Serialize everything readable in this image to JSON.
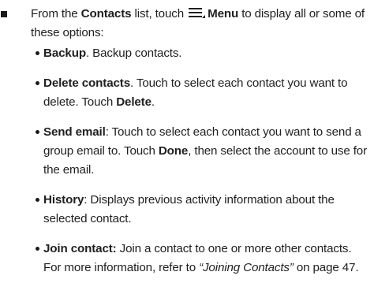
{
  "intro": {
    "part1": "From the ",
    "contacts_label": "Contacts",
    "part2": " list, touch ",
    "menu_icon": "menu-icon",
    "menu_label": "Menu",
    "part3": " to display all or some of these options:"
  },
  "items": [
    {
      "term": "Backup",
      "text1": ". Backup contacts."
    },
    {
      "term": "Delete contacts",
      "text1": ". Touch to select each contact you want to delete. Touch ",
      "emph": "Delete",
      "text2": "."
    },
    {
      "term": "Send email",
      "text1": ": Touch to select each contact you want to send a group email to. Touch ",
      "emph": "Done",
      "text2": ", then select the account to use for the email."
    },
    {
      "term": "History",
      "text1": ": Displays previous activity information about the selected contact."
    },
    {
      "term": "Join contact:",
      "text1": " Join a contact to one or more other contacts. For more information, refer to ",
      "ref": "“Joining Contacts”",
      "text2": " on page 47."
    }
  ]
}
